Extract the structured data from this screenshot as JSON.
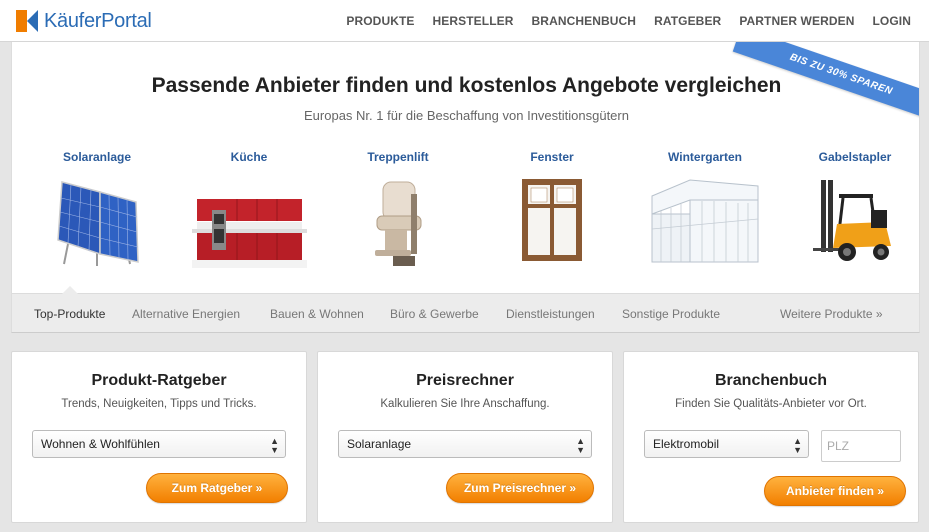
{
  "brand": {
    "name": "KäuferPortal"
  },
  "nav": [
    "PRODUKTE",
    "HERSTELLER",
    "BRANCHENBUCH",
    "RATGEBER",
    "PARTNER WERDEN",
    "LOGIN"
  ],
  "ribbon": "BIS ZU 30% SPAREN",
  "hero": {
    "title": "Passende Anbieter finden und kostenlos Angebote vergleichen",
    "subtitle": "Europas Nr. 1 für die Beschaffung von Investitionsgütern"
  },
  "products": [
    {
      "name": "Solaranlage",
      "icon": "solar-panel-icon"
    },
    {
      "name": "Küche",
      "icon": "kitchen-icon"
    },
    {
      "name": "Treppenlift",
      "icon": "stairlift-icon"
    },
    {
      "name": "Fenster",
      "icon": "window-icon"
    },
    {
      "name": "Wintergarten",
      "icon": "conservatory-icon"
    },
    {
      "name": "Gabelstapler",
      "icon": "forklift-icon"
    }
  ],
  "categories": [
    "Top-Produkte",
    "Alternative Energien",
    "Bauen & Wohnen",
    "Büro & Gewerbe",
    "Dienstleistungen",
    "Sonstige Produkte",
    "Weitere Produkte »"
  ],
  "cards": {
    "ratgeber": {
      "title": "Produkt-Ratgeber",
      "desc": "Trends, Neuigkeiten, Tipps und Tricks.",
      "select": "Wohnen & Wohlfühlen",
      "button": "Zum Ratgeber »"
    },
    "rechner": {
      "title": "Preisrechner",
      "desc": "Kalkulieren Sie Ihre Anschaffung.",
      "select": "Solaranlage",
      "button": "Zum Preisrechner »"
    },
    "branchenbuch": {
      "title": "Branchenbuch",
      "desc": "Finden Sie Qualitäts-Anbieter vor Ort.",
      "select": "Elektromobil",
      "plz_placeholder": "PLZ",
      "button": "Anbieter finden »"
    }
  },
  "colors": {
    "brand_blue": "#2b6cb5",
    "brand_orange": "#f07d00",
    "button_orange": "#f5890f",
    "ribbon_blue": "#4a86d8"
  }
}
